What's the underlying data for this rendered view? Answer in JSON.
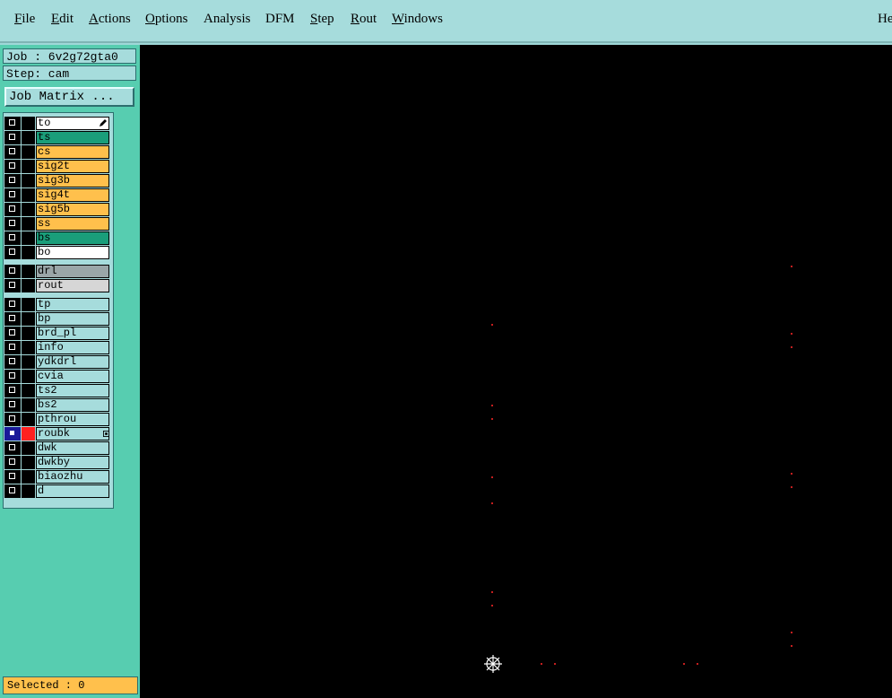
{
  "menubar": {
    "items": [
      {
        "first": "F",
        "rest": "ile"
      },
      {
        "first": "E",
        "rest": "dit"
      },
      {
        "first": "A",
        "rest": "ctions"
      },
      {
        "first": "O",
        "rest": "ptions"
      },
      {
        "first": "A",
        "rest": "nalysis"
      },
      {
        "first": "D",
        "rest": "FM"
      },
      {
        "first": "S",
        "rest": "tep"
      },
      {
        "first": "R",
        "rest": "out"
      },
      {
        "first": "W",
        "rest": "indows"
      },
      {
        "first": "H",
        "rest": "e"
      }
    ]
  },
  "job": {
    "job_label": "Job : 6v2g72gta0",
    "step_label": "Step: cam",
    "matrix_button": "Job Matrix ..."
  },
  "colors": {
    "board_orange": "#ffc04c",
    "mask_green": "#1a9e7a",
    "silk_white": "#ffffff",
    "drill_gray": "#9aa6a8",
    "rout_gray": "#d6d6d6",
    "misc_cyan": "#a6dcdc",
    "canvas_black": "#000000",
    "feature_red": "#c41e1e"
  },
  "layers": {
    "board": [
      {
        "name": "to",
        "color": "#ffffff",
        "note_icon": "pencil-icon"
      },
      {
        "name": "ts",
        "color": "#1a9e7a"
      },
      {
        "name": "cs",
        "color": "#ffc04c"
      },
      {
        "name": "sig2t",
        "color": "#ffc04c"
      },
      {
        "name": "sig3b",
        "color": "#ffc04c"
      },
      {
        "name": "sig4t",
        "color": "#ffc04c"
      },
      {
        "name": "sig5b",
        "color": "#ffc04c"
      },
      {
        "name": "ss",
        "color": "#ffc04c"
      },
      {
        "name": "bs",
        "color": "#1a9e7a"
      },
      {
        "name": "bo",
        "color": "#ffffff"
      }
    ],
    "drill": [
      {
        "name": "drl",
        "color": "#9aa6a8"
      },
      {
        "name": "rout",
        "color": "#d6d6d6"
      }
    ],
    "misc": [
      {
        "name": "tp",
        "color": "#a6dcdc"
      },
      {
        "name": "bp",
        "color": "#a6dcdc"
      },
      {
        "name": "brd_pl",
        "color": "#a6dcdc"
      },
      {
        "name": "info",
        "color": "#a6dcdc"
      },
      {
        "name": "ydkdrl",
        "color": "#a6dcdc"
      },
      {
        "name": "cvia",
        "color": "#a6dcdc"
      },
      {
        "name": "ts2",
        "color": "#a6dcdc"
      },
      {
        "name": "bs2",
        "color": "#a6dcdc"
      },
      {
        "name": "pthrou",
        "color": "#a6dcdc"
      },
      {
        "name": "roubk",
        "color": "#a6dcdc",
        "selected": true
      },
      {
        "name": "dwk",
        "color": "#a6dcdc"
      },
      {
        "name": "dwkby",
        "color": "#a6dcdc"
      },
      {
        "name": "biaozhu",
        "color": "#a6dcdc"
      },
      {
        "name": "d",
        "color": "#a6dcdc"
      }
    ]
  },
  "status": {
    "selected": "Selected : 0"
  }
}
